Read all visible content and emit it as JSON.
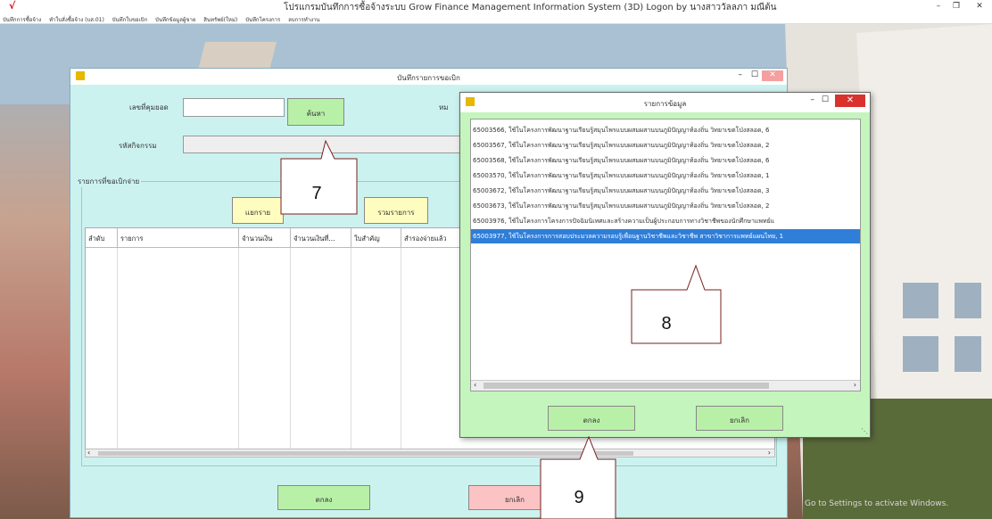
{
  "app": {
    "title": "โปรแกรมบันทึกการซื้อจ้างระบบ Grow Finance Management Information System (3D) Logon by นางสาววัลลภา มณีต้น",
    "menu": [
      "บันทึกการซื้อจ้าง",
      "ทำใบสั่งซื้อจ้าง (บส.01)",
      "บันทึกใบขอเบิก",
      "บันทึกข้อมูลผู้ขาย",
      "สินทรัพย์(ใหม่)",
      "บันทึกโครงการ",
      "ลบการทำงาน"
    ]
  },
  "main_dialog": {
    "title": "บันทึกรายการขอเบิก",
    "doc_no_label": "เลขที่คุมยอด",
    "doc_no_value": "",
    "search_button": "ค้นหา",
    "note_label": "หม",
    "activity_label": "รหัสกิจกรรม",
    "group_label": "รายการที่ขอเบิกจ่าย",
    "split_button": "แยกราย",
    "combine_button": "รวมรายการ",
    "columns": [
      "ลำดับ",
      "รายการ",
      "จำนวนเงิน",
      "จำนวนเงินที่...",
      "ใบสำคัญ",
      "สำรองจ่ายแล้ว"
    ],
    "ok_button": "ตกลง",
    "cancel_button": "ยกเลิก"
  },
  "popup": {
    "title": "รายการข้อมูล",
    "items": [
      "65003566, ใช้ในโครงการพัฒนาฐานเรียนรู้สมุนไพรแบบผสมผสานบนภูมิปัญญาท้องถิ่น วิทยาเขตโป่งสลอด, 6",
      "65003567, ใช้ในโครงการพัฒนาฐานเรียนรู้สมุนไพรแบบผสมผสานบนภูมิปัญญาท้องถิ่น วิทยาเขตโป่งสลอด, 2",
      "65003568, ใช้ในโครงการพัฒนาฐานเรียนรู้สมุนไพรแบบผสมผสานบนภูมิปัญญาท้องถิ่น วิทยาเขตโป่งสลอด, 6",
      "65003570, ใช้ในโครงการพัฒนาฐานเรียนรู้สมุนไพรแบบผสมผสานบนภูมิปัญญาท้องถิ่น วิทยาเขตโป่งสลอด, 1",
      "65003672, ใช้ในโครงการพัฒนาฐานเรียนรู้สมุนไพรแบบผสมผสานบนภูมิปัญญาท้องถิ่น วิทยาเขตโป่งสลอด, 3",
      "65003673, ใช้ในโครงการพัฒนาฐานเรียนรู้สมุนไพรแบบผสมผสานบนภูมิปัญญาท้องถิ่น วิทยาเขตโป่งสลอด, 2",
      "65003976, ใช้ในโครงการโครงการปัจฉิมนิเทศและสร้างความเป็นผู้ประกอบการทางวิชาชีพของนักศึกษาแพทย์แ",
      "65003977, ใช้ในโครงการการสอบประมวลความรอบรู้เพื่อนฐานวิชาชีพและวิชาชีพ สาขาวิชาการแพทย์แผนไทย, 1"
    ],
    "selected_index": 7,
    "ok_button": "ตกลง",
    "cancel_button": "ยกเลิก"
  },
  "callouts": [
    "7",
    "8",
    "9"
  ],
  "watermark": "Go to Settings to activate Windows."
}
